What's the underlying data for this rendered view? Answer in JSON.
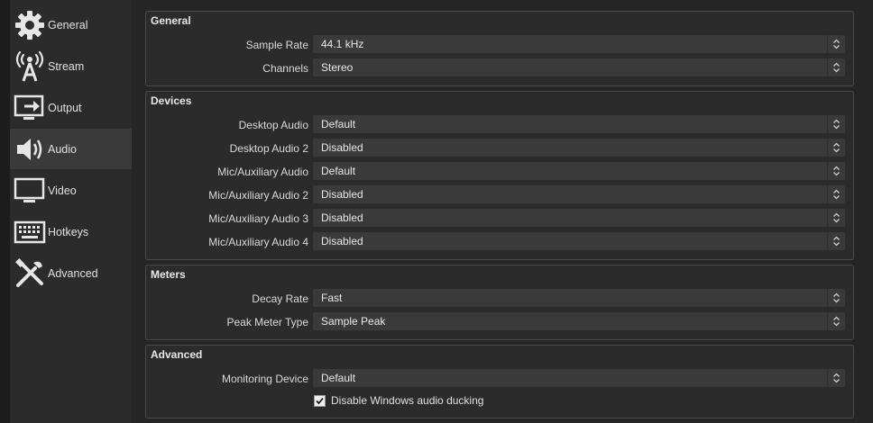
{
  "sidebar": {
    "items": [
      {
        "label": "General",
        "icon": "gear-icon"
      },
      {
        "label": "Stream",
        "icon": "broadcast-icon"
      },
      {
        "label": "Output",
        "icon": "output-icon"
      },
      {
        "label": "Audio",
        "icon": "speaker-icon"
      },
      {
        "label": "Video",
        "icon": "monitor-icon"
      },
      {
        "label": "Hotkeys",
        "icon": "keyboard-icon"
      },
      {
        "label": "Advanced",
        "icon": "tools-icon"
      }
    ],
    "active_index": 3
  },
  "groups": {
    "general": {
      "title": "General",
      "sample_rate": {
        "label": "Sample Rate",
        "value": "44.1 kHz"
      },
      "channels": {
        "label": "Channels",
        "value": "Stereo"
      }
    },
    "devices": {
      "title": "Devices",
      "rows": [
        {
          "label": "Desktop Audio",
          "value": "Default"
        },
        {
          "label": "Desktop Audio 2",
          "value": "Disabled"
        },
        {
          "label": "Mic/Auxiliary Audio",
          "value": "Default"
        },
        {
          "label": "Mic/Auxiliary Audio 2",
          "value": "Disabled"
        },
        {
          "label": "Mic/Auxiliary Audio 3",
          "value": "Disabled"
        },
        {
          "label": "Mic/Auxiliary Audio 4",
          "value": "Disabled"
        }
      ]
    },
    "meters": {
      "title": "Meters",
      "decay_rate": {
        "label": "Decay Rate",
        "value": "Fast"
      },
      "peak_meter_type": {
        "label": "Peak Meter Type",
        "value": "Sample Peak"
      }
    },
    "advanced": {
      "title": "Advanced",
      "monitoring_device": {
        "label": "Monitoring Device",
        "value": "Default"
      },
      "ducking": {
        "label": "Disable Windows audio ducking",
        "checked": true
      }
    }
  },
  "colors": {
    "accent_active": "#3a3a3a",
    "background": "#2b2b2b",
    "input": "#3a3a3a"
  }
}
